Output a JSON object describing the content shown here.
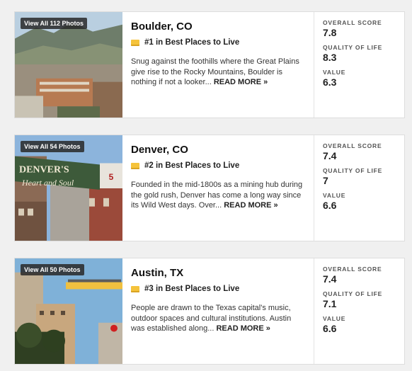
{
  "listings": [
    {
      "photos_label": "View All 112 Photos",
      "city": "Boulder, CO",
      "rank": "#1 in Best Places to Live",
      "description": "Snug against the foothills where the Great Plains give rise to the Rocky Mountains, Boulder is nothing if not a looker...",
      "read_more": "READ MORE »",
      "scores": [
        {
          "label": "OVERALL SCORE",
          "value": "7.8"
        },
        {
          "label": "QUALITY OF LIFE",
          "value": "8.3"
        },
        {
          "label": "VALUE",
          "value": "6.3"
        }
      ]
    },
    {
      "photos_label": "View All 54 Photos",
      "city": "Denver, CO",
      "rank": "#2 in Best Places to Live",
      "description": "Founded in the mid-1800s as a mining hub during the gold rush, Denver has come a long way since its Wild West days. Over...",
      "read_more": "READ MORE »",
      "photo_sign_text": "DENVER'S",
      "photo_sign_script": "Heart and Soul",
      "scores": [
        {
          "label": "OVERALL SCORE",
          "value": "7.4"
        },
        {
          "label": "QUALITY OF LIFE",
          "value": "7"
        },
        {
          "label": "VALUE",
          "value": "6.6"
        }
      ]
    },
    {
      "photos_label": "View All 50 Photos",
      "city": "Austin, TX",
      "rank": "#3 in Best Places to Live",
      "description": "People are drawn to the Texas capital's music, outdoor spaces and cultural institutions. Austin was established along...",
      "read_more": "READ MORE »",
      "scores": [
        {
          "label": "OVERALL SCORE",
          "value": "7.4"
        },
        {
          "label": "QUALITY OF LIFE",
          "value": "7.1"
        },
        {
          "label": "VALUE",
          "value": "6.6"
        }
      ]
    }
  ],
  "colors": {
    "rank_icon": "#f5c33b",
    "card_border": "#dddddd",
    "page_bg": "#f0f0f0"
  }
}
